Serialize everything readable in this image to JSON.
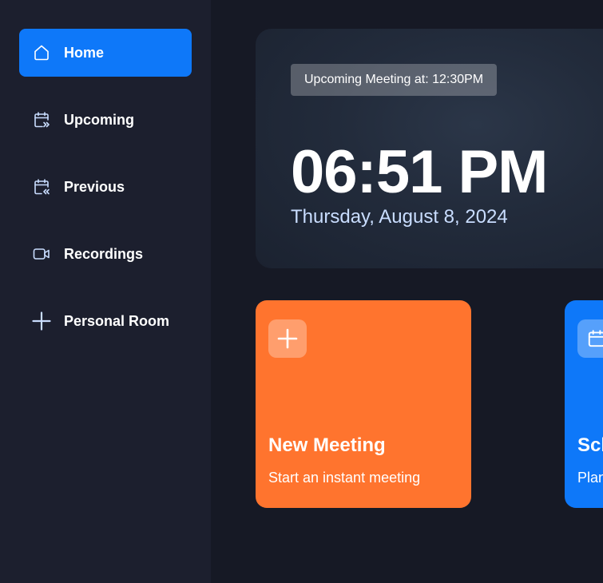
{
  "sidebar": {
    "items": [
      {
        "label": "Home",
        "icon": "home-icon",
        "active": true
      },
      {
        "label": "Upcoming",
        "icon": "calendar-forward-icon",
        "active": false
      },
      {
        "label": "Previous",
        "icon": "calendar-back-icon",
        "active": false
      },
      {
        "label": "Recordings",
        "icon": "video-icon",
        "active": false
      },
      {
        "label": "Personal Room",
        "icon": "plus-icon",
        "active": false
      }
    ]
  },
  "hero": {
    "badge": "Upcoming Meeting at: 12:30PM",
    "time": "06:51 PM",
    "date": "Thursday, August 8, 2024"
  },
  "cards": [
    {
      "title": "New Meeting",
      "subtitle": "Start an instant meeting",
      "icon": "plus-icon",
      "color": "#ff742e"
    },
    {
      "title": "Schedule Meeting",
      "subtitle": "Plan your meeting",
      "icon": "calendar-icon",
      "color": "#0e78f9"
    }
  ],
  "colors": {
    "accent": "#0e78f9",
    "sidebar_bg": "#1c1f2e",
    "page_bg": "#161925",
    "orange": "#ff742e",
    "date_text": "#c9ddff"
  }
}
